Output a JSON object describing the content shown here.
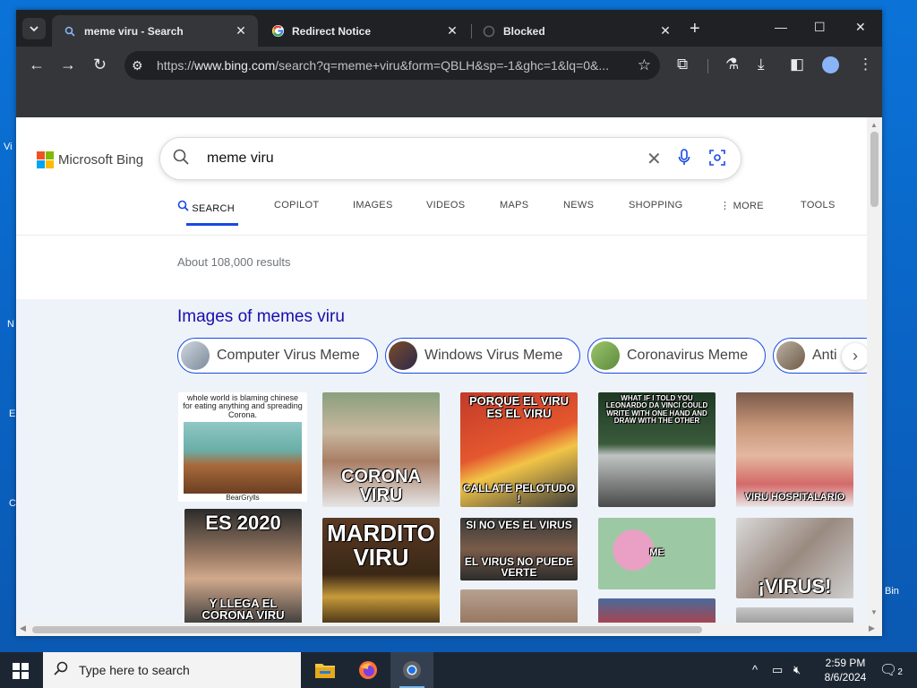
{
  "browser": {
    "tabs": [
      {
        "title": "meme viru - Search",
        "active": true,
        "icon": "bing-search-icon"
      },
      {
        "title": "Redirect Notice",
        "active": false,
        "icon": "google-icon"
      },
      {
        "title": "Blocked",
        "active": false,
        "icon": "loading-icon"
      }
    ],
    "url_prefix": "https://",
    "url_host": "www.bing.com",
    "url_rest": "/search?q=meme+viru&form=QBLH&sp=-1&ghc=1&lq=0&..."
  },
  "bing": {
    "logo_text": "Microsoft Bing",
    "query": "meme viru",
    "nav": [
      {
        "label": "SEARCH",
        "active": true
      },
      {
        "label": "COPILOT"
      },
      {
        "label": "IMAGES"
      },
      {
        "label": "VIDEOS"
      },
      {
        "label": "MAPS"
      },
      {
        "label": "NEWS"
      },
      {
        "label": "SHOPPING"
      },
      {
        "label": "MORE"
      },
      {
        "label": "TOOLS"
      }
    ],
    "results_count": "About 108,000 results",
    "images_title": "Images of memes viru",
    "pills": [
      "Computer Virus Meme",
      "Windows Virus Meme",
      "Coronavirus Meme",
      "Anti"
    ],
    "images": [
      {
        "caption_top": "whole world is blaming chinese for eating anything and spreading Corona.",
        "caption_bottom": "BearGrylls"
      },
      {
        "caption_top": "",
        "caption_bottom": "CORONA VIRU"
      },
      {
        "caption_top": "PORQUE EL VIRU ES EL VIRU",
        "caption_bottom": "CALLATE PELOTUDO !"
      },
      {
        "caption_top": "WHAT IF I TOLD YOU LEONARDO DA VINCI COULD WRITE WITH ONE HAND AND DRAW WITH THE OTHER",
        "caption_bottom": ""
      },
      {
        "caption_top": "",
        "caption_bottom": "VIRU HOSPITALARIO"
      },
      {
        "caption_top": "ES 2020",
        "caption_bottom": "Y LLEGA EL CORONA VIRU"
      },
      {
        "caption_top": "MARDITO VIRU",
        "caption_bottom": ""
      },
      {
        "caption_top": "SI NO VES EL VIRUS",
        "caption_bottom": "EL VIRUS NO PUEDE VERTE"
      },
      {
        "caption_top": "",
        "caption_bottom": "ME"
      },
      {
        "caption_top": "",
        "caption_bottom": "¡VIRUS!"
      }
    ]
  },
  "taskbar": {
    "search_placeholder": "Type here to search",
    "time": "2:59 PM",
    "date": "8/6/2024",
    "notification_count": "2"
  },
  "desktop": {
    "recycle_bin_label": "Bin"
  }
}
